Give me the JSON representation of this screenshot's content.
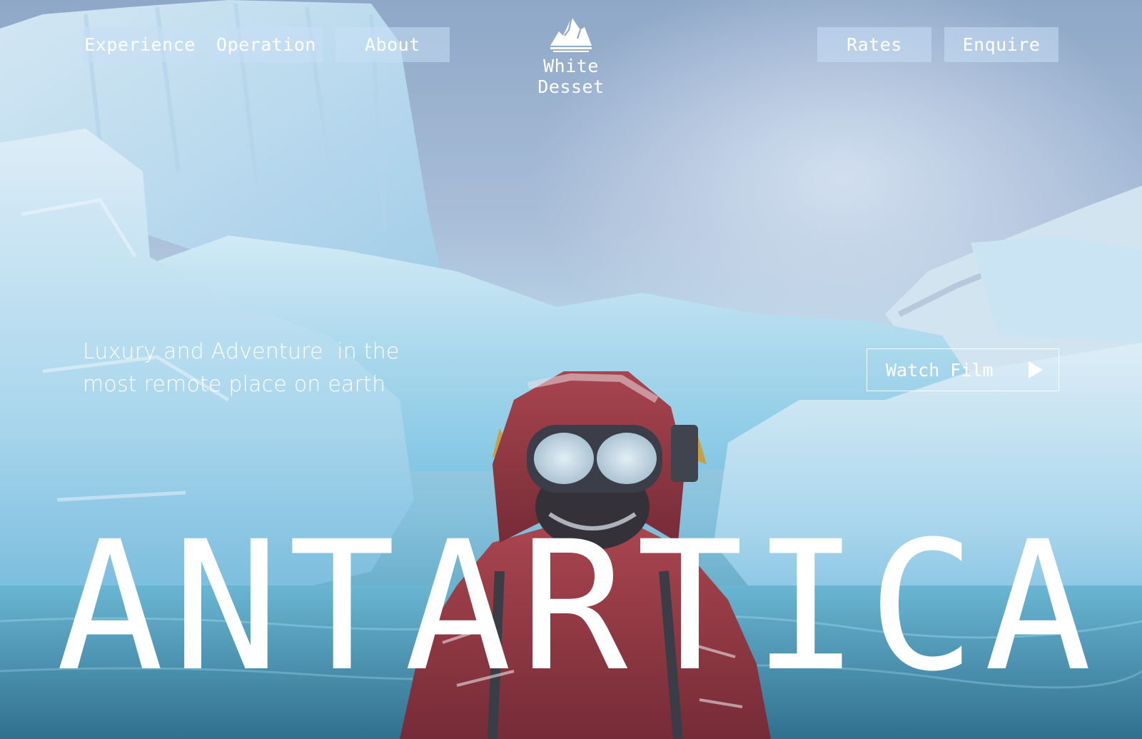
{
  "header": {
    "nav_left": [
      "Experience",
      "Operation",
      "About"
    ],
    "nav_right": [
      "Rates",
      "Enquire"
    ],
    "brand": "White Desset",
    "brand_icon": "mountain-icon"
  },
  "hero": {
    "tagline_line1": "Luxury and Adventure  in the",
    "tagline_line2": "most remote place on earth",
    "watch_label": "Watch Film",
    "watch_icon": "play-icon",
    "title": "ANTARTICA"
  },
  "colors": {
    "nav_bg": "#c8def5",
    "text": "#ffffff",
    "jacket": "#8e2028",
    "ice": "#bfe3f1",
    "water": "#2e7f9f"
  }
}
